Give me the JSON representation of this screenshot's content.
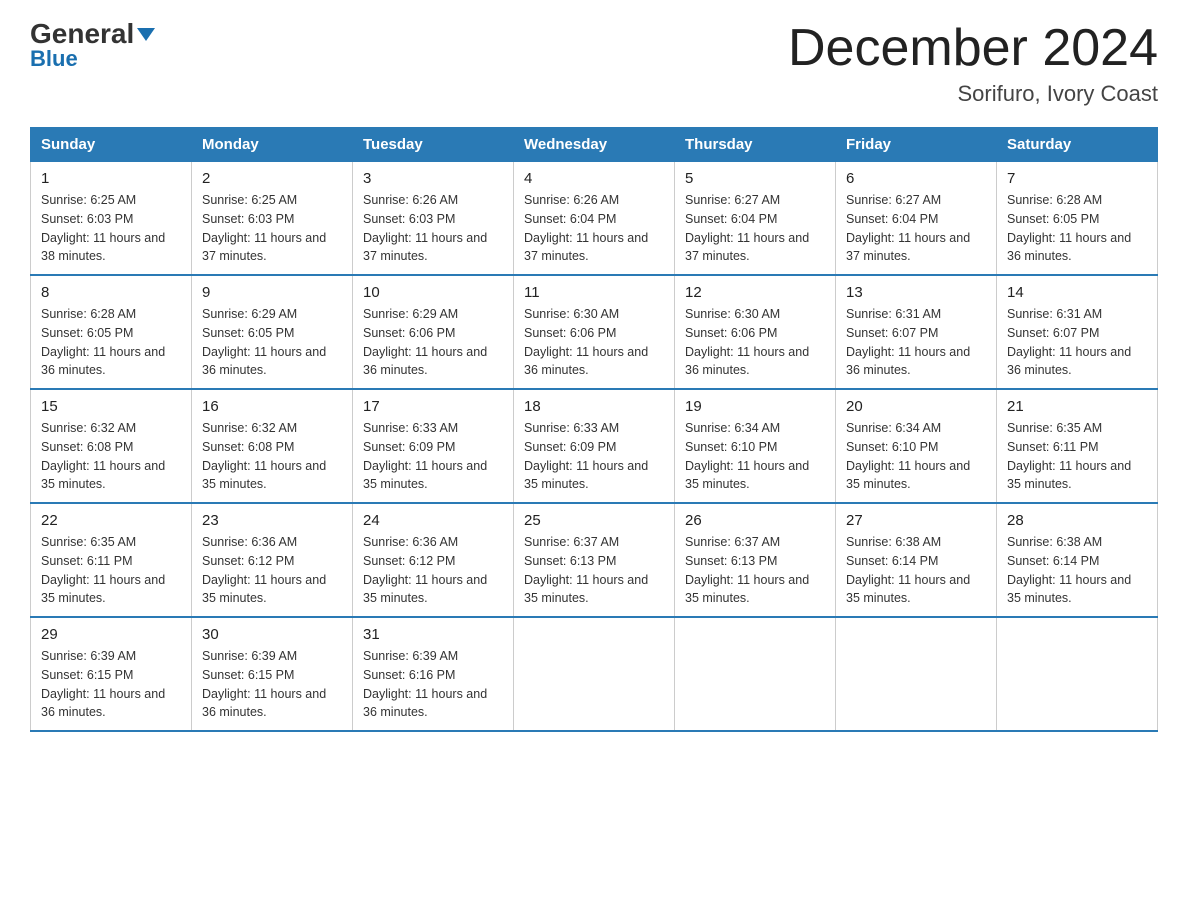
{
  "header": {
    "logo_general": "General",
    "logo_blue": "Blue",
    "month_year": "December 2024",
    "location": "Sorifuro, Ivory Coast"
  },
  "weekdays": [
    "Sunday",
    "Monday",
    "Tuesday",
    "Wednesday",
    "Thursday",
    "Friday",
    "Saturday"
  ],
  "weeks": [
    [
      {
        "day": "1",
        "sunrise": "6:25 AM",
        "sunset": "6:03 PM",
        "daylight": "11 hours and 38 minutes."
      },
      {
        "day": "2",
        "sunrise": "6:25 AM",
        "sunset": "6:03 PM",
        "daylight": "11 hours and 37 minutes."
      },
      {
        "day": "3",
        "sunrise": "6:26 AM",
        "sunset": "6:03 PM",
        "daylight": "11 hours and 37 minutes."
      },
      {
        "day": "4",
        "sunrise": "6:26 AM",
        "sunset": "6:04 PM",
        "daylight": "11 hours and 37 minutes."
      },
      {
        "day": "5",
        "sunrise": "6:27 AM",
        "sunset": "6:04 PM",
        "daylight": "11 hours and 37 minutes."
      },
      {
        "day": "6",
        "sunrise": "6:27 AM",
        "sunset": "6:04 PM",
        "daylight": "11 hours and 37 minutes."
      },
      {
        "day": "7",
        "sunrise": "6:28 AM",
        "sunset": "6:05 PM",
        "daylight": "11 hours and 36 minutes."
      }
    ],
    [
      {
        "day": "8",
        "sunrise": "6:28 AM",
        "sunset": "6:05 PM",
        "daylight": "11 hours and 36 minutes."
      },
      {
        "day": "9",
        "sunrise": "6:29 AM",
        "sunset": "6:05 PM",
        "daylight": "11 hours and 36 minutes."
      },
      {
        "day": "10",
        "sunrise": "6:29 AM",
        "sunset": "6:06 PM",
        "daylight": "11 hours and 36 minutes."
      },
      {
        "day": "11",
        "sunrise": "6:30 AM",
        "sunset": "6:06 PM",
        "daylight": "11 hours and 36 minutes."
      },
      {
        "day": "12",
        "sunrise": "6:30 AM",
        "sunset": "6:06 PM",
        "daylight": "11 hours and 36 minutes."
      },
      {
        "day": "13",
        "sunrise": "6:31 AM",
        "sunset": "6:07 PM",
        "daylight": "11 hours and 36 minutes."
      },
      {
        "day": "14",
        "sunrise": "6:31 AM",
        "sunset": "6:07 PM",
        "daylight": "11 hours and 36 minutes."
      }
    ],
    [
      {
        "day": "15",
        "sunrise": "6:32 AM",
        "sunset": "6:08 PM",
        "daylight": "11 hours and 35 minutes."
      },
      {
        "day": "16",
        "sunrise": "6:32 AM",
        "sunset": "6:08 PM",
        "daylight": "11 hours and 35 minutes."
      },
      {
        "day": "17",
        "sunrise": "6:33 AM",
        "sunset": "6:09 PM",
        "daylight": "11 hours and 35 minutes."
      },
      {
        "day": "18",
        "sunrise": "6:33 AM",
        "sunset": "6:09 PM",
        "daylight": "11 hours and 35 minutes."
      },
      {
        "day": "19",
        "sunrise": "6:34 AM",
        "sunset": "6:10 PM",
        "daylight": "11 hours and 35 minutes."
      },
      {
        "day": "20",
        "sunrise": "6:34 AM",
        "sunset": "6:10 PM",
        "daylight": "11 hours and 35 minutes."
      },
      {
        "day": "21",
        "sunrise": "6:35 AM",
        "sunset": "6:11 PM",
        "daylight": "11 hours and 35 minutes."
      }
    ],
    [
      {
        "day": "22",
        "sunrise": "6:35 AM",
        "sunset": "6:11 PM",
        "daylight": "11 hours and 35 minutes."
      },
      {
        "day": "23",
        "sunrise": "6:36 AM",
        "sunset": "6:12 PM",
        "daylight": "11 hours and 35 minutes."
      },
      {
        "day": "24",
        "sunrise": "6:36 AM",
        "sunset": "6:12 PM",
        "daylight": "11 hours and 35 minutes."
      },
      {
        "day": "25",
        "sunrise": "6:37 AM",
        "sunset": "6:13 PM",
        "daylight": "11 hours and 35 minutes."
      },
      {
        "day": "26",
        "sunrise": "6:37 AM",
        "sunset": "6:13 PM",
        "daylight": "11 hours and 35 minutes."
      },
      {
        "day": "27",
        "sunrise": "6:38 AM",
        "sunset": "6:14 PM",
        "daylight": "11 hours and 35 minutes."
      },
      {
        "day": "28",
        "sunrise": "6:38 AM",
        "sunset": "6:14 PM",
        "daylight": "11 hours and 35 minutes."
      }
    ],
    [
      {
        "day": "29",
        "sunrise": "6:39 AM",
        "sunset": "6:15 PM",
        "daylight": "11 hours and 36 minutes."
      },
      {
        "day": "30",
        "sunrise": "6:39 AM",
        "sunset": "6:15 PM",
        "daylight": "11 hours and 36 minutes."
      },
      {
        "day": "31",
        "sunrise": "6:39 AM",
        "sunset": "6:16 PM",
        "daylight": "11 hours and 36 minutes."
      },
      null,
      null,
      null,
      null
    ]
  ]
}
